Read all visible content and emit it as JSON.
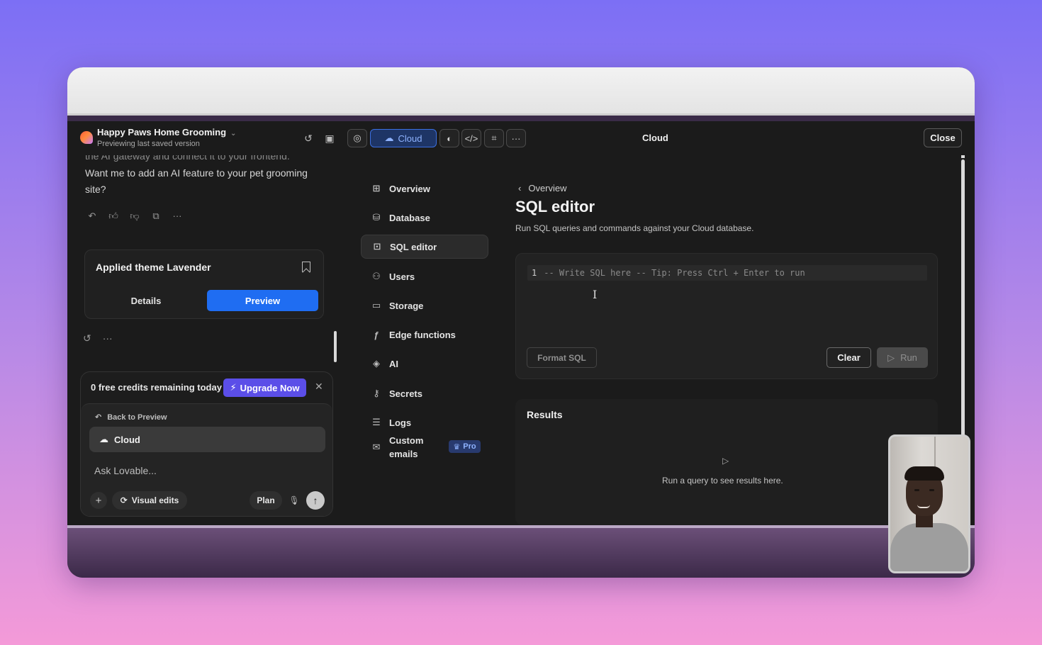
{
  "header": {
    "project_name": "Happy Paws Home Grooming",
    "project_sub": "Previewing last saved version",
    "cloud_tab_label": "Cloud",
    "title": "Cloud",
    "close_label": "Close"
  },
  "chat": {
    "cut_text": "the AI gateway and connect it to your frontend.",
    "message": "Want me to add an AI feature to your pet grooming site?",
    "theme_card": {
      "title": "Applied theme Lavender",
      "details_label": "Details",
      "preview_label": "Preview"
    }
  },
  "composer": {
    "credits_text": "0 free credits remaining today",
    "upgrade_label": "Upgrade Now",
    "back_label": "Back to Preview",
    "cloud_label": "Cloud",
    "placeholder": "Ask Lovable...",
    "visual_edits_label": "Visual edits",
    "plan_label": "Plan"
  },
  "nav": {
    "items": [
      {
        "label": "Overview",
        "icon": "grid-icon"
      },
      {
        "label": "Database",
        "icon": "database-icon"
      },
      {
        "label": "SQL editor",
        "icon": "terminal-icon",
        "active": true
      },
      {
        "label": "Users",
        "icon": "users-icon"
      },
      {
        "label": "Storage",
        "icon": "storage-icon"
      },
      {
        "label": "Edge functions",
        "icon": "function-icon"
      },
      {
        "label": "AI",
        "icon": "ai-icon"
      },
      {
        "label": "Secrets",
        "icon": "key-icon"
      },
      {
        "label": "Logs",
        "icon": "list-icon"
      },
      {
        "label": "Custom emails",
        "icon": "mail-icon",
        "badge": "Pro"
      }
    ]
  },
  "main": {
    "breadcrumb": "Overview",
    "title": "SQL editor",
    "subtitle": "Run SQL queries and commands against your Cloud database.",
    "editor": {
      "line_number": "1",
      "placeholder": "-- Write SQL here -- Tip: Press Ctrl + Enter to run",
      "format_label": "Format SQL",
      "clear_label": "Clear",
      "run_label": "Run"
    },
    "results": {
      "title": "Results",
      "empty_text": "Run a query to see results here."
    }
  },
  "colors": {
    "accent_blue": "#1f6df2",
    "upgrade_purple": "#5b4ee8",
    "app_bg": "#1b1b1b"
  }
}
